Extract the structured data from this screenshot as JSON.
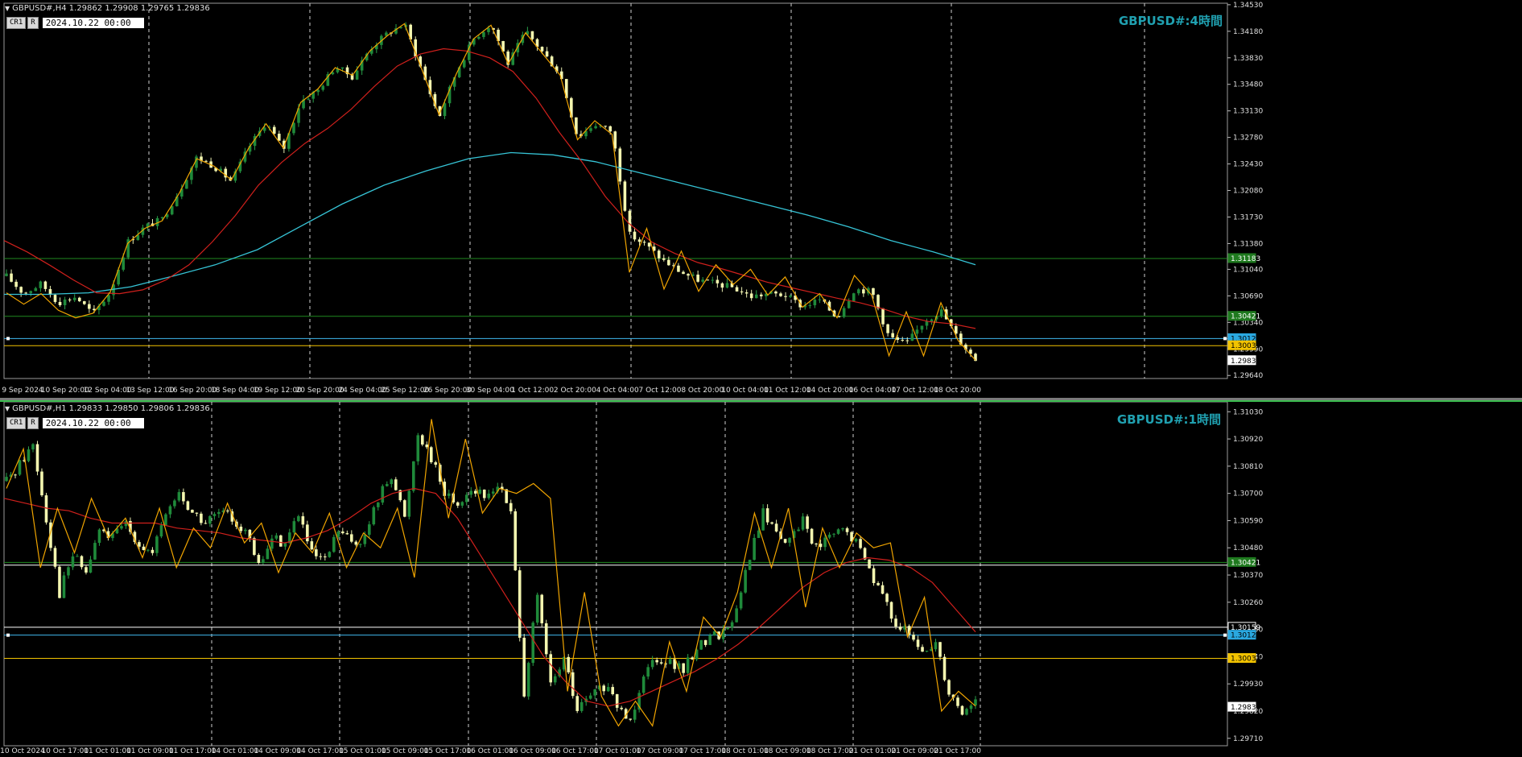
{
  "chart_data": [
    {
      "type": "candlestick",
      "symbol_header": "GBPUSD#,H4  1.29862 1.29908 1.29765 1.29836",
      "tags": [
        "CR1",
        "R"
      ],
      "date_box": "2024.10.22 00:00",
      "title": "GBPUSD#:4時間",
      "y_ticks": [
        "1.34530",
        "1.34180",
        "1.33830",
        "1.33480",
        "1.33130",
        "1.32780",
        "1.32430",
        "1.32080",
        "1.31730",
        "1.31380",
        "1.31040",
        "1.30690",
        "1.30340",
        "1.29990",
        "1.29640"
      ],
      "ylim": [
        1.296,
        1.3455
      ],
      "x_ticks": [
        "9 Sep 2024",
        "10 Sep 20:00",
        "12 Sep 04:00",
        "13 Sep 12:00",
        "16 Sep 20:00",
        "18 Sep 04:00",
        "19 Sep 12:00",
        "20 Sep 20:00",
        "24 Sep 04:00",
        "25 Sep 12:00",
        "26 Sep 20:00",
        "30 Sep 04:00",
        "1 Oct 12:00",
        "2 Oct 20:00",
        "4 Oct 04:00",
        "7 Oct 12:00",
        "8 Oct 20:00",
        "10 Oct 04:00",
        "11 Oct 12:00",
        "14 Oct 20:00",
        "16 Oct 04:00",
        "17 Oct 12:00",
        "18 Oct 20:00"
      ],
      "price_labels": [
        {
          "value": "1.31183",
          "price": 1.31183,
          "bg": "#1f7a1f",
          "fg": "#ffffff"
        },
        {
          "value": "1.30421",
          "price": 1.30421,
          "bg": "#1f7a1f",
          "fg": "#ffffff"
        },
        {
          "value": "1.30127",
          "price": 1.30127,
          "bg": "#2aa8e0",
          "fg": "#000000"
        },
        {
          "value": "1.30033",
          "price": 1.30033,
          "bg": "#f2c300",
          "fg": "#000000"
        },
        {
          "value": "1.29836",
          "price": 1.29836,
          "bg": "#ffffff",
          "fg": "#000000"
        }
      ],
      "hlines": [
        {
          "price": 1.31183,
          "color": "#1f8a1f"
        },
        {
          "price": 1.30421,
          "color": "#1f8a1f"
        },
        {
          "price": 1.30127,
          "color": "#3fb8ef"
        },
        {
          "price": 1.30033,
          "color": "#f2c300"
        }
      ],
      "close_path": [
        1.3095,
        1.3072,
        1.3085,
        1.306,
        1.3068,
        1.3045,
        1.3074,
        1.314,
        1.316,
        1.317,
        1.3208,
        1.3252,
        1.324,
        1.322,
        1.3265,
        1.3298,
        1.3262,
        1.3326,
        1.334,
        1.3372,
        1.3358,
        1.3395,
        1.3415,
        1.3428,
        1.3366,
        1.3305,
        1.3365,
        1.3408,
        1.3428,
        1.3375,
        1.3418,
        1.339,
        1.3362,
        1.3278,
        1.3296,
        1.3286,
        1.315,
        1.3135,
        1.3115,
        1.31,
        1.309,
        1.3085,
        1.308,
        1.3068,
        1.3072,
        1.307,
        1.3055,
        1.3064,
        1.304,
        1.3078,
        1.3075,
        1.3015,
        1.3005,
        1.3035,
        1.305,
        1.3012,
        1.2985
      ],
      "zigzag": [
        1.3073,
        1.3058,
        1.3072,
        1.305,
        1.304,
        1.3046,
        1.3074,
        1.3138,
        1.3158,
        1.3168,
        1.3205,
        1.325,
        1.324,
        1.3222,
        1.3264,
        1.3296,
        1.3264,
        1.3324,
        1.3342,
        1.337,
        1.336,
        1.3392,
        1.3412,
        1.3428,
        1.3368,
        1.3308,
        1.3362,
        1.3408,
        1.3426,
        1.3375,
        1.3416,
        1.3388,
        1.336,
        1.3275,
        1.33,
        1.3282,
        1.31,
        1.3158,
        1.3078,
        1.3128,
        1.3075,
        1.311,
        1.3084,
        1.3104,
        1.307,
        1.3094,
        1.3054,
        1.3072,
        1.304,
        1.3096,
        1.307,
        1.299,
        1.3048,
        1.299,
        1.306,
        1.301,
        1.2984
      ],
      "ema_red": [
        1.3142,
        1.3127,
        1.3109,
        1.309,
        1.3073,
        1.3072,
        1.3077,
        1.309,
        1.311,
        1.314,
        1.3175,
        1.3215,
        1.3245,
        1.327,
        1.329,
        1.3315,
        1.3345,
        1.3372,
        1.3388,
        1.3395,
        1.3392,
        1.3383,
        1.3365,
        1.333,
        1.3285,
        1.3245,
        1.32,
        1.3165,
        1.314,
        1.3125,
        1.3113,
        1.3105,
        1.3096,
        1.3087,
        1.308,
        1.3073,
        1.3066,
        1.306,
        1.3052,
        1.3042,
        1.3035,
        1.3032,
        1.3026
      ],
      "ema_cyan": [
        1.3071,
        1.3071,
        1.3073,
        1.3081,
        1.3095,
        1.311,
        1.313,
        1.316,
        1.319,
        1.3215,
        1.3234,
        1.325,
        1.3258,
        1.3255,
        1.3246,
        1.3232,
        1.3218,
        1.3204,
        1.319,
        1.3176,
        1.316,
        1.3142,
        1.3127,
        1.311
      ]
    },
    {
      "type": "candlestick",
      "symbol_header": "GBPUSD#,H1  1.29833 1.29850 1.29806 1.29836",
      "tags": [
        "CR1",
        "R"
      ],
      "date_box": "2024.10.22 00:00",
      "title": "GBPUSD#:1時間",
      "y_ticks": [
        "1.31030",
        "1.30920",
        "1.30810",
        "1.30700",
        "1.30590",
        "1.30480",
        "1.30370",
        "1.30260",
        "1.30150",
        "1.30040",
        "1.29930",
        "1.29820",
        "1.29710"
      ],
      "ylim": [
        1.2968,
        1.3107
      ],
      "x_ticks": [
        "10 Oct 2024",
        "10 Oct 17:00",
        "11 Oct 01:00",
        "11 Oct 09:00",
        "11 Oct 17:00",
        "14 Oct 01:00",
        "14 Oct 09:00",
        "14 Oct 17:00",
        "15 Oct 01:00",
        "15 Oct 09:00",
        "15 Oct 17:00",
        "16 Oct 01:00",
        "16 Oct 09:00",
        "16 Oct 17:00",
        "17 Oct 01:00",
        "17 Oct 09:00",
        "17 Oct 17:00",
        "18 Oct 01:00",
        "18 Oct 09:00",
        "18 Oct 17:00",
        "21 Oct 01:00",
        "21 Oct 09:00",
        "21 Oct 17:00"
      ],
      "price_labels": [
        {
          "value": "1.30421",
          "price": 1.30421,
          "bg": "#1f7a1f",
          "fg": "#ffffff"
        },
        {
          "value": "1.30159",
          "price": 1.30159,
          "bg": "#000000",
          "fg": "#ffffff"
        },
        {
          "value": "1.30127",
          "price": 1.30127,
          "bg": "#2aa8e0",
          "fg": "#000000"
        },
        {
          "value": "1.30033",
          "price": 1.30033,
          "bg": "#f2c300",
          "fg": "#000000"
        },
        {
          "value": "1.29836",
          "price": 1.29836,
          "bg": "#ffffff",
          "fg": "#000000"
        }
      ],
      "hlines": [
        {
          "price": 1.30421,
          "color": "#1f8a1f"
        },
        {
          "price": 1.3041,
          "color": "#ffffff"
        },
        {
          "price": 1.30159,
          "color": "#ffffff"
        },
        {
          "price": 1.30127,
          "color": "#3fb8ef"
        },
        {
          "price": 1.30033,
          "color": "#f2c300"
        }
      ],
      "close_path": [
        1.3075,
        1.3082,
        1.309,
        1.306,
        1.303,
        1.3045,
        1.3038,
        1.3055,
        1.3052,
        1.3058,
        1.305,
        1.3045,
        1.3062,
        1.307,
        1.3062,
        1.3058,
        1.3062,
        1.306,
        1.3055,
        1.304,
        1.3052,
        1.305,
        1.3062,
        1.3045,
        1.3042,
        1.3055,
        1.305,
        1.3052,
        1.3068,
        1.3078,
        1.306,
        1.3095,
        1.3085,
        1.307,
        1.3066,
        1.3072,
        1.3068,
        1.3074,
        1.3062,
        1.299,
        1.3028,
        1.2992,
        1.3003,
        1.2982,
        1.2988,
        1.2992,
        1.2984,
        1.2978,
        1.2998,
        1.3004,
        1.3002,
        1.2998,
        1.3008,
        1.3012,
        1.3014,
        1.3022,
        1.3045,
        1.3062,
        1.3055,
        1.305,
        1.306,
        1.3048,
        1.3052,
        1.3055,
        1.305,
        1.304,
        1.3028,
        1.3018,
        1.3012,
        1.3005,
        1.301,
        1.299,
        1.2982,
        1.2986
      ],
      "zigzag": [
        1.3072,
        1.3088,
        1.304,
        1.3064,
        1.3046,
        1.3068,
        1.3052,
        1.306,
        1.3044,
        1.3064,
        1.304,
        1.3056,
        1.3048,
        1.3066,
        1.305,
        1.3058,
        1.3038,
        1.3054,
        1.3046,
        1.3062,
        1.304,
        1.3054,
        1.3048,
        1.3064,
        1.3036,
        1.31,
        1.306,
        1.3092,
        1.3062,
        1.3072,
        1.307,
        1.3074,
        1.3068,
        1.299,
        1.303,
        1.2988,
        1.2976,
        1.2986,
        1.2976,
        1.301,
        1.299,
        1.302,
        1.3012,
        1.303,
        1.3062,
        1.304,
        1.3064,
        1.3024,
        1.3056,
        1.304,
        1.3054,
        1.3048,
        1.305,
        1.3012,
        1.3028,
        1.2982,
        1.299,
        1.2984
      ],
      "ema_red": [
        1.3068,
        1.3066,
        1.3064,
        1.3063,
        1.306,
        1.3058,
        1.3058,
        1.3058,
        1.3056,
        1.3055,
        1.3054,
        1.3052,
        1.3051,
        1.305,
        1.3052,
        1.3055,
        1.306,
        1.3066,
        1.307,
        1.3072,
        1.307,
        1.306,
        1.3046,
        1.3032,
        1.3018,
        1.3004,
        1.2994,
        1.2986,
        1.2984,
        1.2986,
        1.299,
        1.2994,
        1.2998,
        1.3003,
        1.3009,
        1.3016,
        1.3024,
        1.3032,
        1.3038,
        1.3042,
        1.3044,
        1.3043,
        1.304,
        1.3034,
        1.3024,
        1.3014
      ]
    }
  ]
}
